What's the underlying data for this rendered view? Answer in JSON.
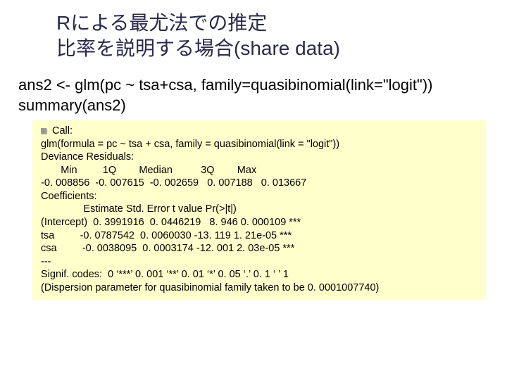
{
  "title_line1": "Rによる最尤法での推定",
  "title_line2": "比率を説明する場合(share data)",
  "code_line1": "ans2 <- glm(pc ~ tsa+csa, family=quasibinomial(link=\"logit\"))",
  "code_line2": "summary(ans2)",
  "output": "Call:\nglm(formula = pc ~ tsa + csa, family = quasibinomial(link = \"logit\"))\nDeviance Residuals:\n       Min         1Q        Median          3Q        Max\n-0. 008856  -0. 007615  -0. 002659   0. 007188   0. 013667\nCoefficients:\n               Estimate Std. Error t value Pr(>|t|)\n(Intercept)  0. 3991916  0. 0446219   8. 946 0. 000109 ***\ntsa         -0. 0787542  0. 0060030 -13. 119 1. 21e-05 ***\ncsa         -0. 0038095  0. 0003174 -12. 001 2. 03e-05 ***\n---\nSignif. codes:  0 ‘***’ 0. 001 ‘**’ 0. 01 ‘*’ 0. 05 ‘.’ 0. 1 ‘ ’ 1\n(Dispersion parameter for quasibinomial family taken to be 0. 0001007740)"
}
